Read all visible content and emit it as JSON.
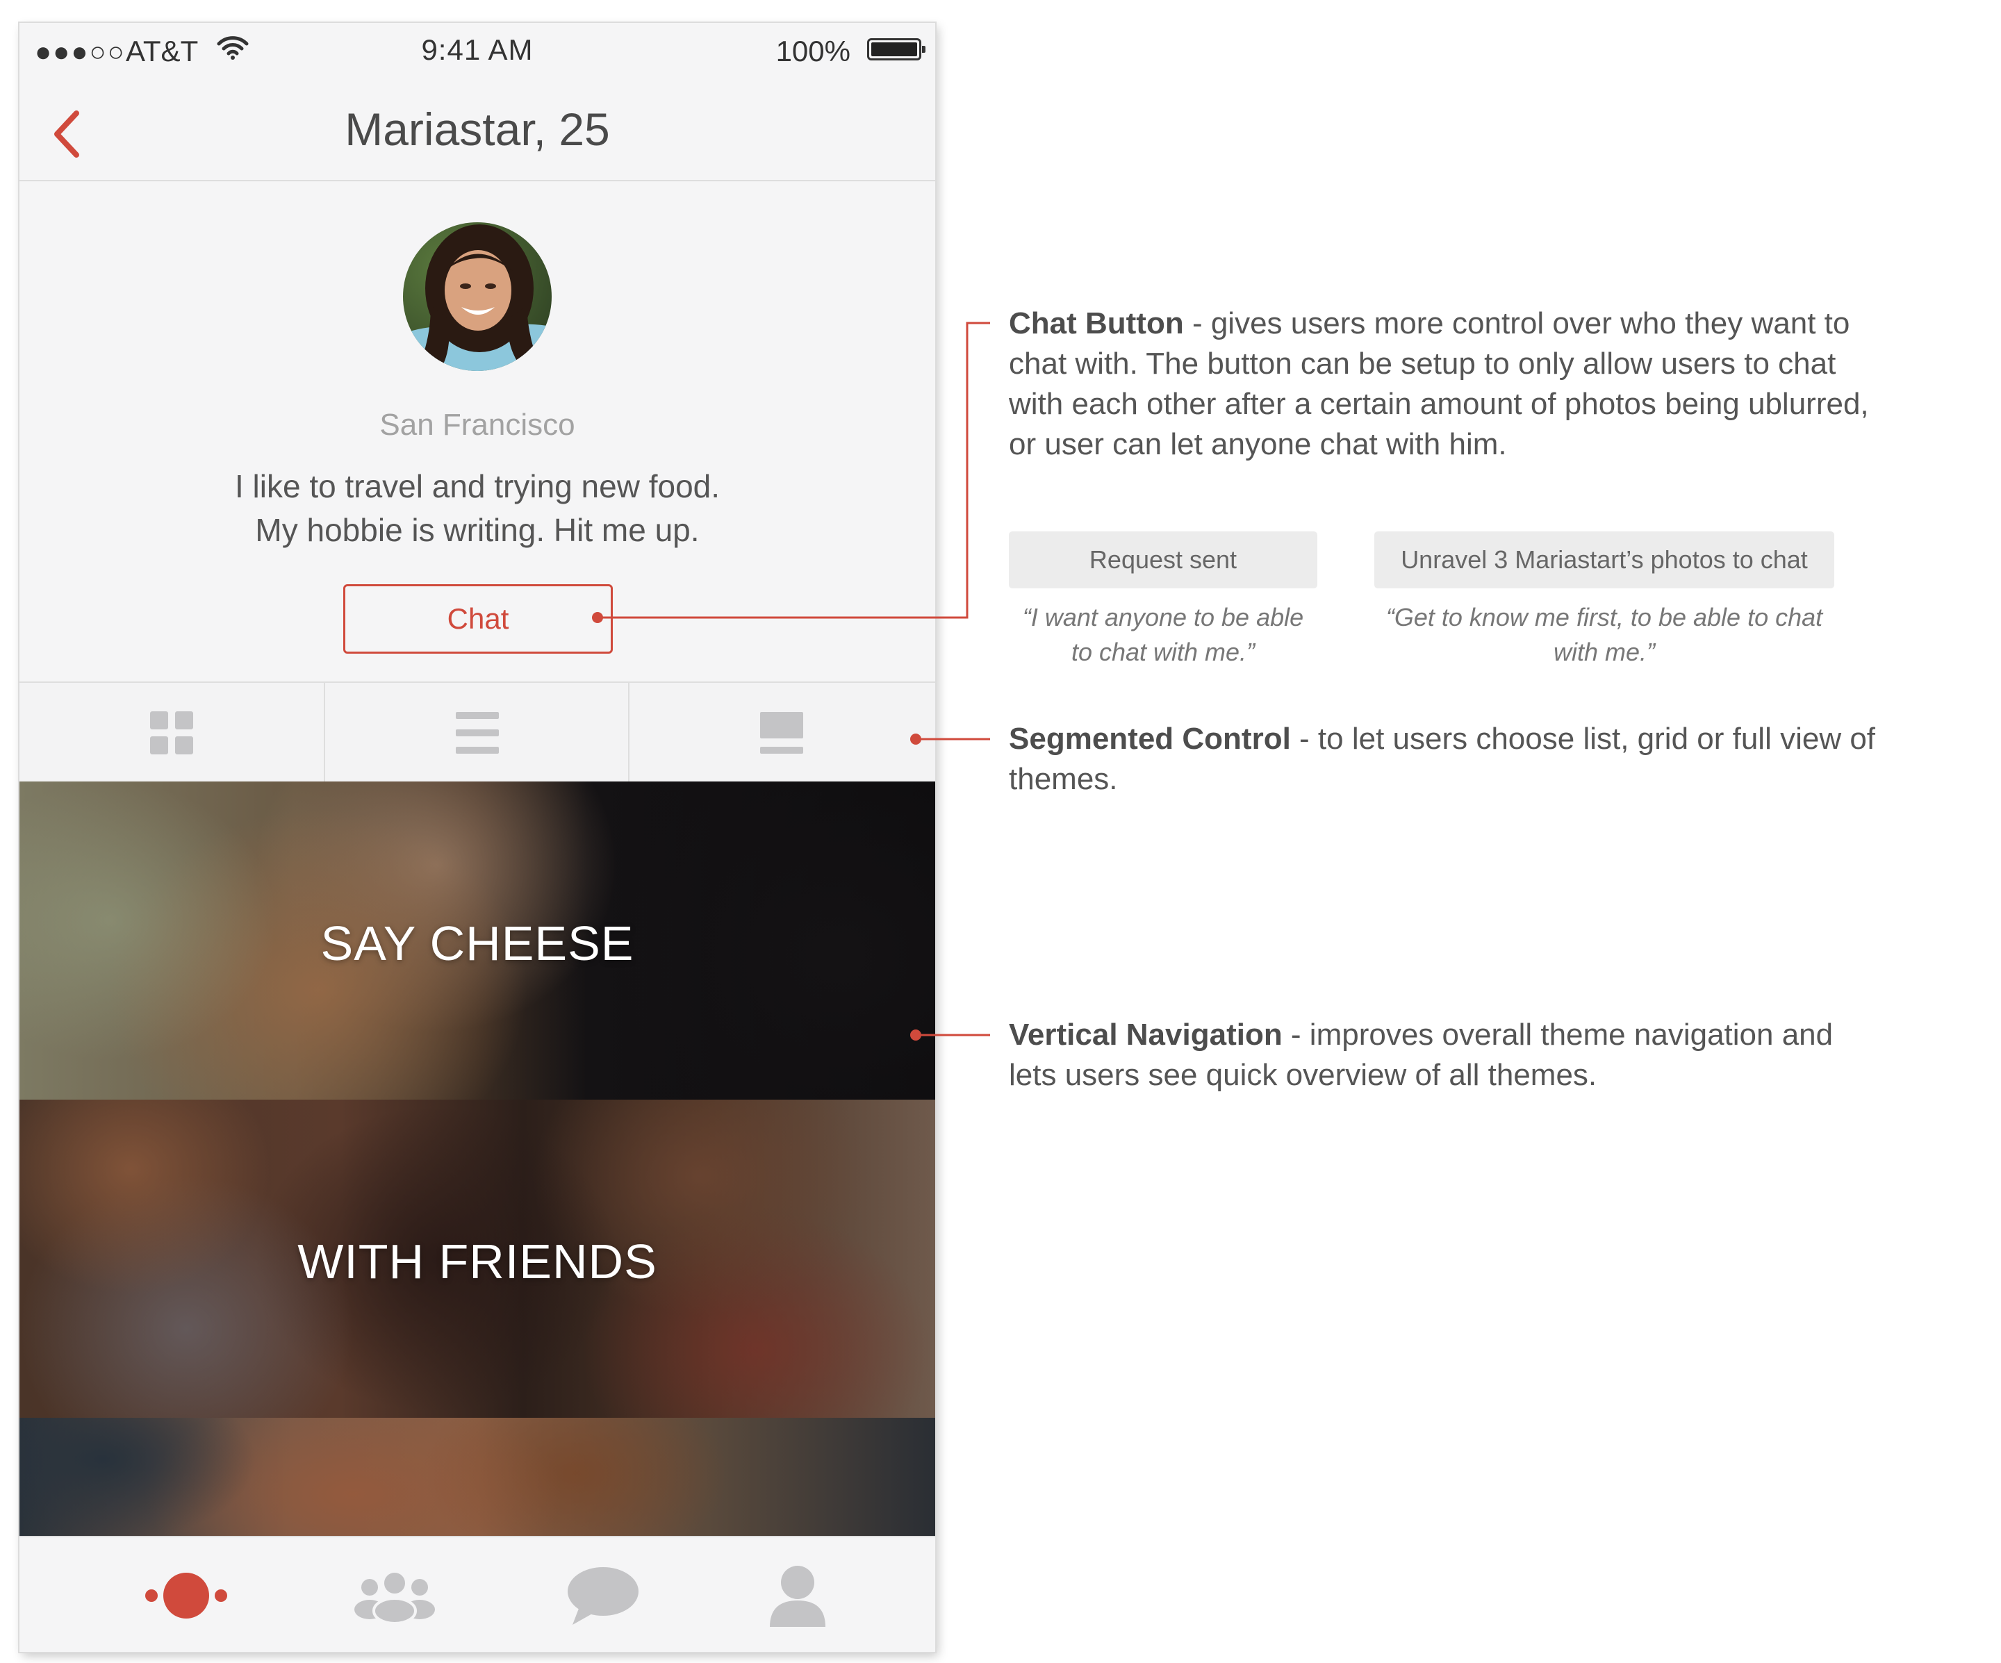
{
  "status_bar": {
    "signal": "●●●○○",
    "carrier": "AT&T",
    "time": "9:41 AM",
    "battery": "100%"
  },
  "nav": {
    "back_icon": "chevron-left-icon",
    "title": "Mariastar, 25"
  },
  "profile": {
    "location": "San Francisco",
    "bio_line1": "I like to travel and trying new food.",
    "bio_line2": "My hobbie is writing. Hit me up.",
    "chat_label": "Chat"
  },
  "segmented": {
    "options": [
      "grid-view-icon",
      "list-view-icon",
      "full-view-icon"
    ]
  },
  "themes": [
    {
      "title": "SAY CHEESE"
    },
    {
      "title": "WITH FRIENDS"
    },
    {
      "title": ""
    }
  ],
  "tab_bar": {
    "items": [
      "discover-icon",
      "friends-icon",
      "chat-bubble-icon",
      "profile-icon"
    ],
    "active": "discover-icon"
  },
  "annotations": {
    "chat_button": {
      "heading": "Chat Button",
      "text": " - gives users more control over who they want to chat with. The button can be setup to only allow users to chat with each other after a certain amount of photos being ublurred, or user can let anyone chat with him.",
      "example1_label": "Request sent",
      "example1_quote": "“I want anyone to be able to chat with me.”",
      "example2_label": "Unravel 3 Mariastart’s photos to chat",
      "example2_quote": "“Get to know me first, to be able to chat with me.”"
    },
    "segmented_control": {
      "heading": "Segmented Control",
      "text": " - to let users choose list, grid or full view of themes."
    },
    "vertical_navigation": {
      "heading": "Vertical Navigation",
      "text": " - improves overall theme navigation and lets users see quick overview of all themes."
    }
  },
  "colors": {
    "accent": "#d04a3c",
    "icon_gray": "#c4c4c6",
    "text": "#555555",
    "background": "#f5f5f6"
  }
}
